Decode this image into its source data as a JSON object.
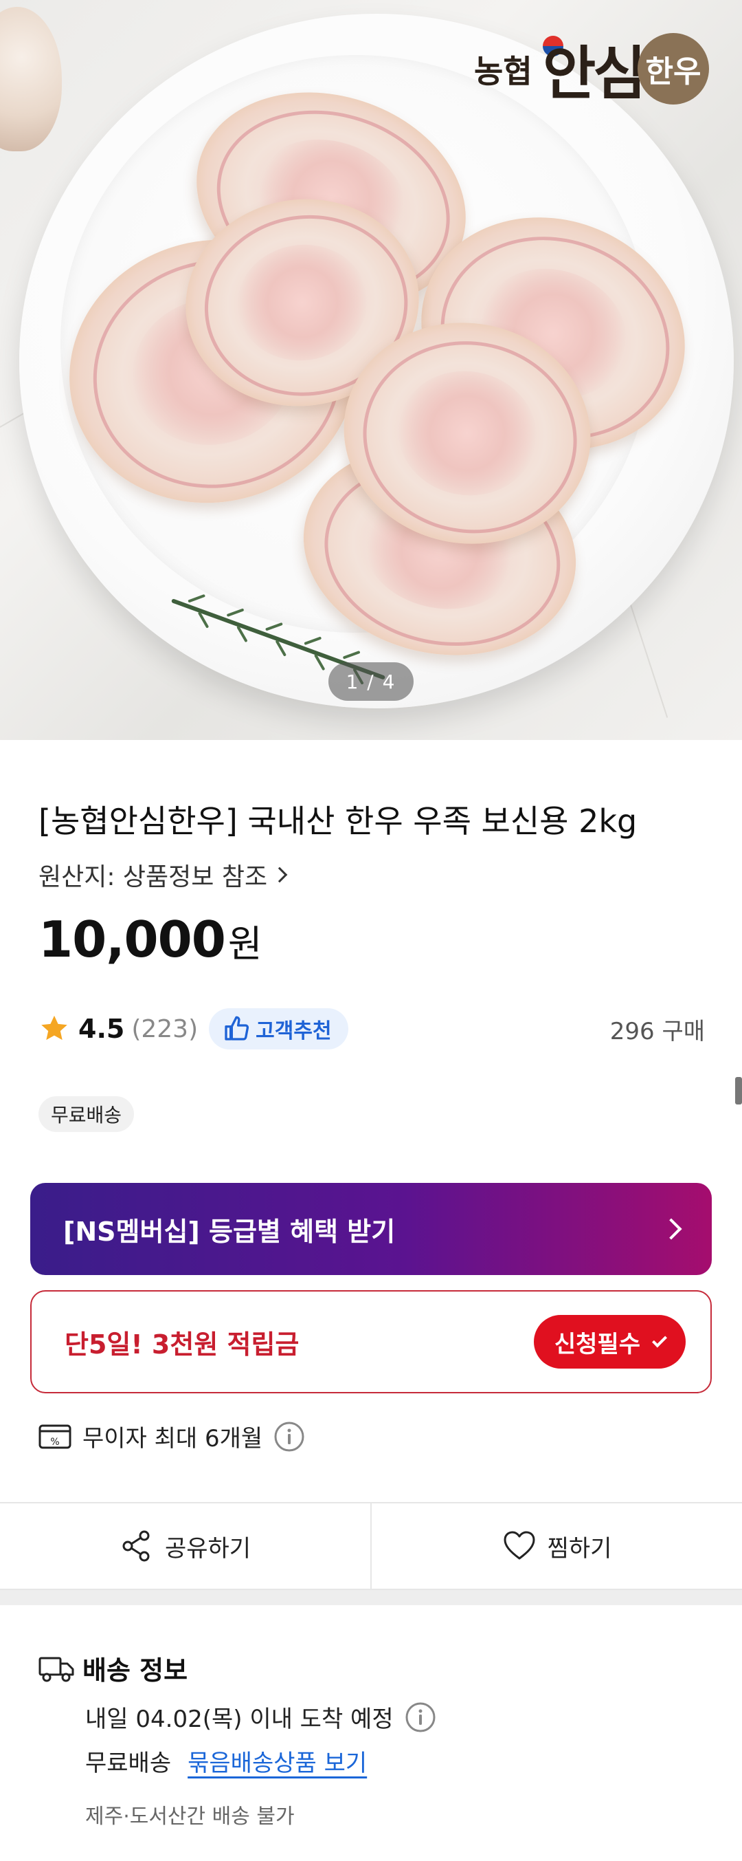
{
  "hero": {
    "logo_text_small": "농협",
    "logo_text_big": "안심",
    "logo_text_circle": "한우",
    "pager": "1 / 4"
  },
  "product": {
    "title": "[농협안심한우] 국내산 한우 우족 보신용 2kg",
    "origin": "원산지: 상품정보 참조",
    "price": "10,000",
    "price_unit": "원",
    "rating": "4.5",
    "review_count": "(223)",
    "recommend_badge": "고객추천",
    "purchase_count": "296 구매",
    "tag_free_shipping": "무료배송"
  },
  "promos": {
    "membership_label": "[NS멤버십] 등급별 혜택 받기",
    "point_label": "단5일! 3천원 적립금",
    "apply_button": "신청필수",
    "installment_label": "무이자 최대 6개월"
  },
  "actions": {
    "share_label": "공유하기",
    "wish_label": "찜하기"
  },
  "shipping": {
    "title": "배송 정보",
    "eta": "내일 04.02(목) 이내 도착 예정",
    "free_label": "무료배송",
    "bundle_link": "묶음배송상품 보기",
    "note": "제주·도서산간 배송 불가"
  },
  "colors": {
    "accent_red": "#e0101f",
    "link_blue": "#1a66d8",
    "badge_blue": "#1f63d6",
    "star": "#f5a623",
    "membership_start": "#3a1d8a",
    "membership_end": "#a50d6e"
  },
  "icons": {
    "star": "star-icon",
    "thumb": "thumbs-up-icon",
    "card": "card-percent-icon",
    "info": "info-icon",
    "share": "share-icon",
    "heart": "heart-icon",
    "truck": "truck-icon",
    "chevron": "chevron-right-icon",
    "check": "check-icon"
  }
}
